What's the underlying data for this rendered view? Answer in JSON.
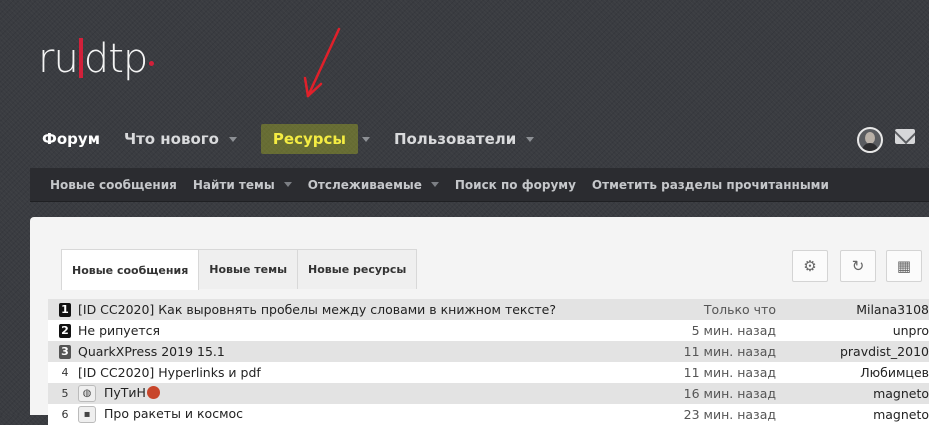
{
  "logo": {
    "part1": "ru",
    "part2": "dtp"
  },
  "main_nav": [
    {
      "label": "Форум"
    },
    {
      "label": "Что нового"
    },
    {
      "label": "Ресурсы"
    },
    {
      "label": "Пользователи"
    }
  ],
  "sub_nav": [
    {
      "label": "Новые сообщения"
    },
    {
      "label": "Найти темы"
    },
    {
      "label": "Отслеживаемые"
    },
    {
      "label": "Поиск по форуму"
    },
    {
      "label": "Отметить разделы прочитанными"
    }
  ],
  "tabs": [
    {
      "label": "Новые сообщения"
    },
    {
      "label": "Новые темы"
    },
    {
      "label": "Новые ресурсы"
    }
  ],
  "tools": {
    "settings": "⚙",
    "refresh": "↻",
    "layout": "▦"
  },
  "icons": {
    "accent_highlight": "#f4ec42",
    "brand": "#d2203a"
  },
  "threads": [
    {
      "num": "1",
      "title": "[ID CC2020]  Как выровнять пробелы между словами в книжном тексте?",
      "time": "Только что",
      "user": "Milana3108"
    },
    {
      "num": "2",
      "title": "Не рипуется",
      "time": "5 мин. назад",
      "user": "unpro"
    },
    {
      "num": "3",
      "title": "QuarkXPress 2019 15.1",
      "time": "11 мин. назад",
      "user": "pravdist_2010"
    },
    {
      "num": "4",
      "title": "[ID CC2020]  Hyperlinks и pdf",
      "time": "11 мин. назад",
      "user": "Любимцев"
    },
    {
      "num": "5",
      "title": "ПуТиН",
      "time": "16 мин. назад",
      "user": "magneto"
    },
    {
      "num": "6",
      "title": "Про ракеты и космос",
      "time": "23 мин. назад",
      "user": "magneto"
    }
  ]
}
